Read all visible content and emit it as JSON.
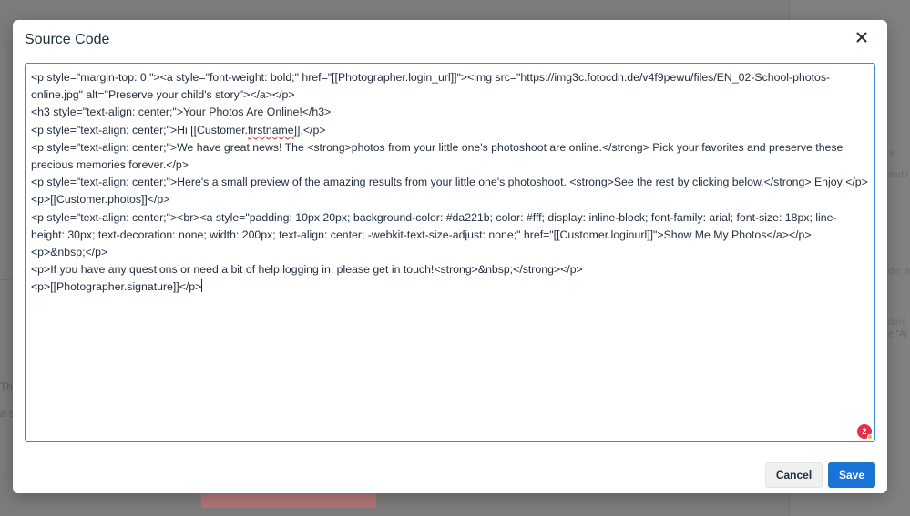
{
  "background": {
    "left_fragments": [
      "Th",
      "a s"
    ],
    "right_fragments": [
      "e",
      "and i",
      "der ar",
      "ders",
      "e \"Al"
    ]
  },
  "modal": {
    "title": "Source Code",
    "close_icon": "close-icon",
    "code_lines": [
      "<p style=\"margin-top: 0;\"><a style=\"font-weight: bold;\" href=\"[[Photographer.login_url]]\"><img src=\"https://img3c.fotocdn.de/v4f9pewu/files/EN_02-School-photos-online.jpg\" alt=\"Preserve your child's story\"></a></p>",
      "<h3 style=\"text-align: center;\">Your Photos Are Online!</h3>",
      "<p style=\"text-align: center;\">Hi [[Customer.",
      "firstname",
      "]],</p>",
      "<p style=\"text-align: center;\">We have great news! The <strong>photos from your little one's photoshoot are online.</strong> Pick your favorites and preserve these precious memories forever.</p>",
      "<p style=\"text-align: center;\">Here's a small preview of the amazing results from your little one's photoshoot. <strong>See the rest by clicking below.</strong> Enjoy!</p>",
      "<p>[[Customer.photos]]</p>",
      "<p style=\"text-align: center;\"><br><a style=\"padding: 10px 20px; background-color: #da221b; color: #fff; display: inline-block; font-family: arial; font-size: 18px; line-height: 30px; text-decoration: none; width: 200px; text-align: center; -webkit-text-size-adjust: none;\" href=\"[[Customer.loginurl]]\">Show Me My Photos</a></p>",
      "<p>&nbsp;</p>",
      "<p>If you have any questions or need a bit of help logging in, please get in touch!<strong>&nbsp;</strong></p>",
      "<p>[[Photographer.signature]]</p>"
    ],
    "notification_badge_count": "2",
    "cancel_label": "Cancel",
    "save_label": "Save"
  },
  "colors": {
    "accent": "#1a73d9",
    "focus_border": "#3a89d6",
    "badge": "#e2334e",
    "text": "#222f3e"
  }
}
